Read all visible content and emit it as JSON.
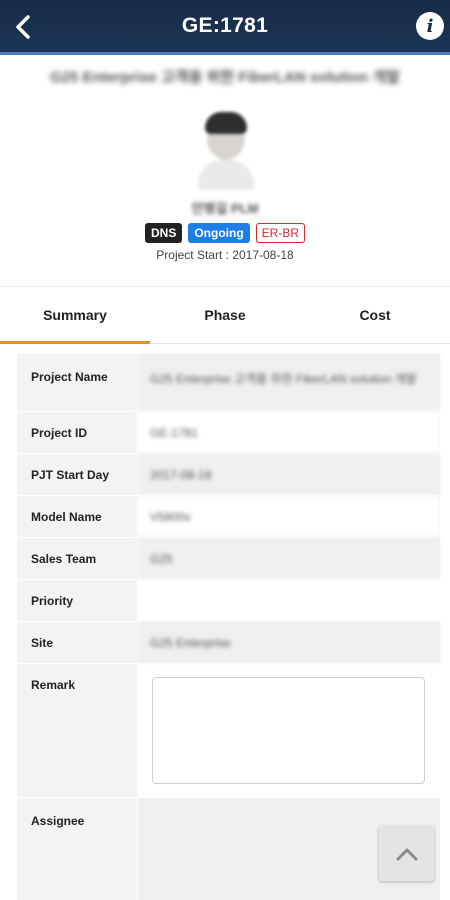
{
  "appbar": {
    "title": "GE:1781"
  },
  "project": {
    "title": "G25 Enterprise 고객용 위한 FiberLAN solution 개발",
    "person_name": "안병길 PLM",
    "badges": [
      "DNS",
      "Ongoing",
      "ER-BR"
    ],
    "start_text": "Project Start : 2017-08-18"
  },
  "tabs": [
    {
      "label": "Summary",
      "active": true
    },
    {
      "label": "Phase",
      "active": false
    },
    {
      "label": "Cost",
      "active": false
    }
  ],
  "summary": {
    "rows": [
      {
        "label": "Project Name",
        "value": "G25 Enterprise 고객용 위한 FiberLAN solution 개발"
      },
      {
        "label": "Project ID",
        "value": "GE-1781"
      },
      {
        "label": "PJT Start Day",
        "value": "2017-08-18"
      },
      {
        "label": "Model Name",
        "value": "V5800v"
      },
      {
        "label": "Sales Team",
        "value": "G25"
      },
      {
        "label": "Priority",
        "value": ""
      },
      {
        "label": "Site",
        "value": "G25 Enterprise"
      },
      {
        "label": "Remark",
        "value": ""
      },
      {
        "label": "Assignee",
        "value": ""
      }
    ]
  },
  "colors": {
    "appbar": "#1a2f4e",
    "tab_indicator": "#f08a24",
    "badge_ongoing": "#1e7ee8",
    "badge_erbr": "#d42a2a"
  },
  "icons": {
    "back": "chevron-left-icon",
    "info": "info-icon",
    "scroll_top": "chevron-up-icon"
  }
}
